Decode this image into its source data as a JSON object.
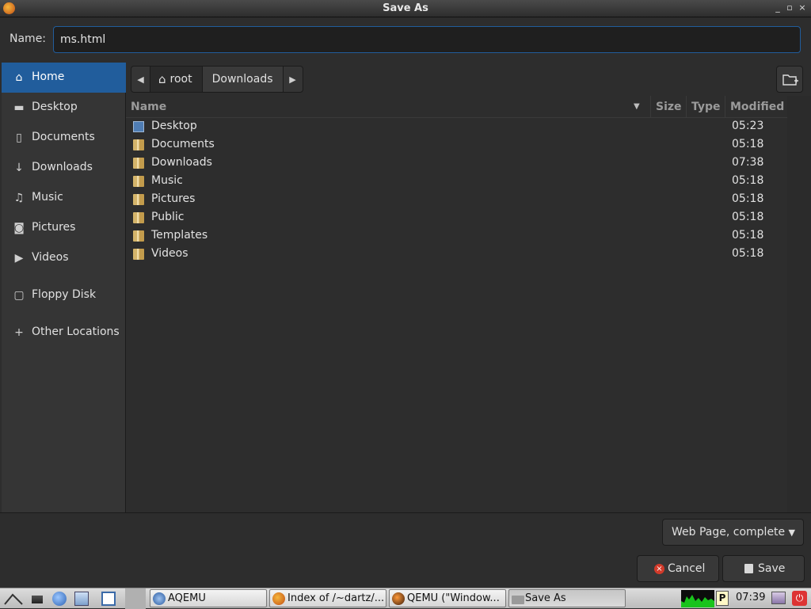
{
  "window": {
    "title": "Save As",
    "controls": [
      "_",
      "▫",
      "×"
    ]
  },
  "name_field": {
    "label": "Name:",
    "value": "ms.html"
  },
  "sidebar": {
    "items": [
      {
        "label": "Home",
        "icon": "home-icon",
        "active": true
      },
      {
        "label": "Desktop",
        "icon": "desktop-icon"
      },
      {
        "label": "Documents",
        "icon": "document-icon"
      },
      {
        "label": "Downloads",
        "icon": "download-icon"
      },
      {
        "label": "Music",
        "icon": "music-icon"
      },
      {
        "label": "Pictures",
        "icon": "camera-icon"
      },
      {
        "label": "Videos",
        "icon": "video-icon"
      },
      {
        "label": "Floppy Disk",
        "icon": "floppy-icon"
      },
      {
        "label": "Other Locations",
        "icon": "plus-icon"
      }
    ]
  },
  "pathbar": {
    "segments": [
      "root",
      "Downloads"
    ]
  },
  "file_list": {
    "columns": {
      "name": "Name",
      "size": "Size",
      "type": "Type",
      "modified": "Modified"
    },
    "rows": [
      {
        "name": "Desktop",
        "modified": "05:23",
        "icon": "desktop-folder-icon"
      },
      {
        "name": "Documents",
        "modified": "05:18",
        "icon": "folder-icon"
      },
      {
        "name": "Downloads",
        "modified": "07:38",
        "icon": "folder-icon"
      },
      {
        "name": "Music",
        "modified": "05:18",
        "icon": "folder-icon"
      },
      {
        "name": "Pictures",
        "modified": "05:18",
        "icon": "folder-icon"
      },
      {
        "name": "Public",
        "modified": "05:18",
        "icon": "folder-icon"
      },
      {
        "name": "Templates",
        "modified": "05:18",
        "icon": "folder-icon"
      },
      {
        "name": "Videos",
        "modified": "05:18",
        "icon": "folder-icon"
      }
    ]
  },
  "filter": {
    "selected": "Web Page, complete"
  },
  "buttons": {
    "cancel": "Cancel",
    "save": "Save"
  },
  "taskbar": {
    "tasks": [
      "AQEMU",
      "Index of /~dartz/...",
      "QEMU (\"Window...",
      "Save As"
    ],
    "clock": "07:39",
    "tray_p": "P"
  },
  "colors": {
    "accent": "#215d9c",
    "background": "#2d2d2d"
  }
}
